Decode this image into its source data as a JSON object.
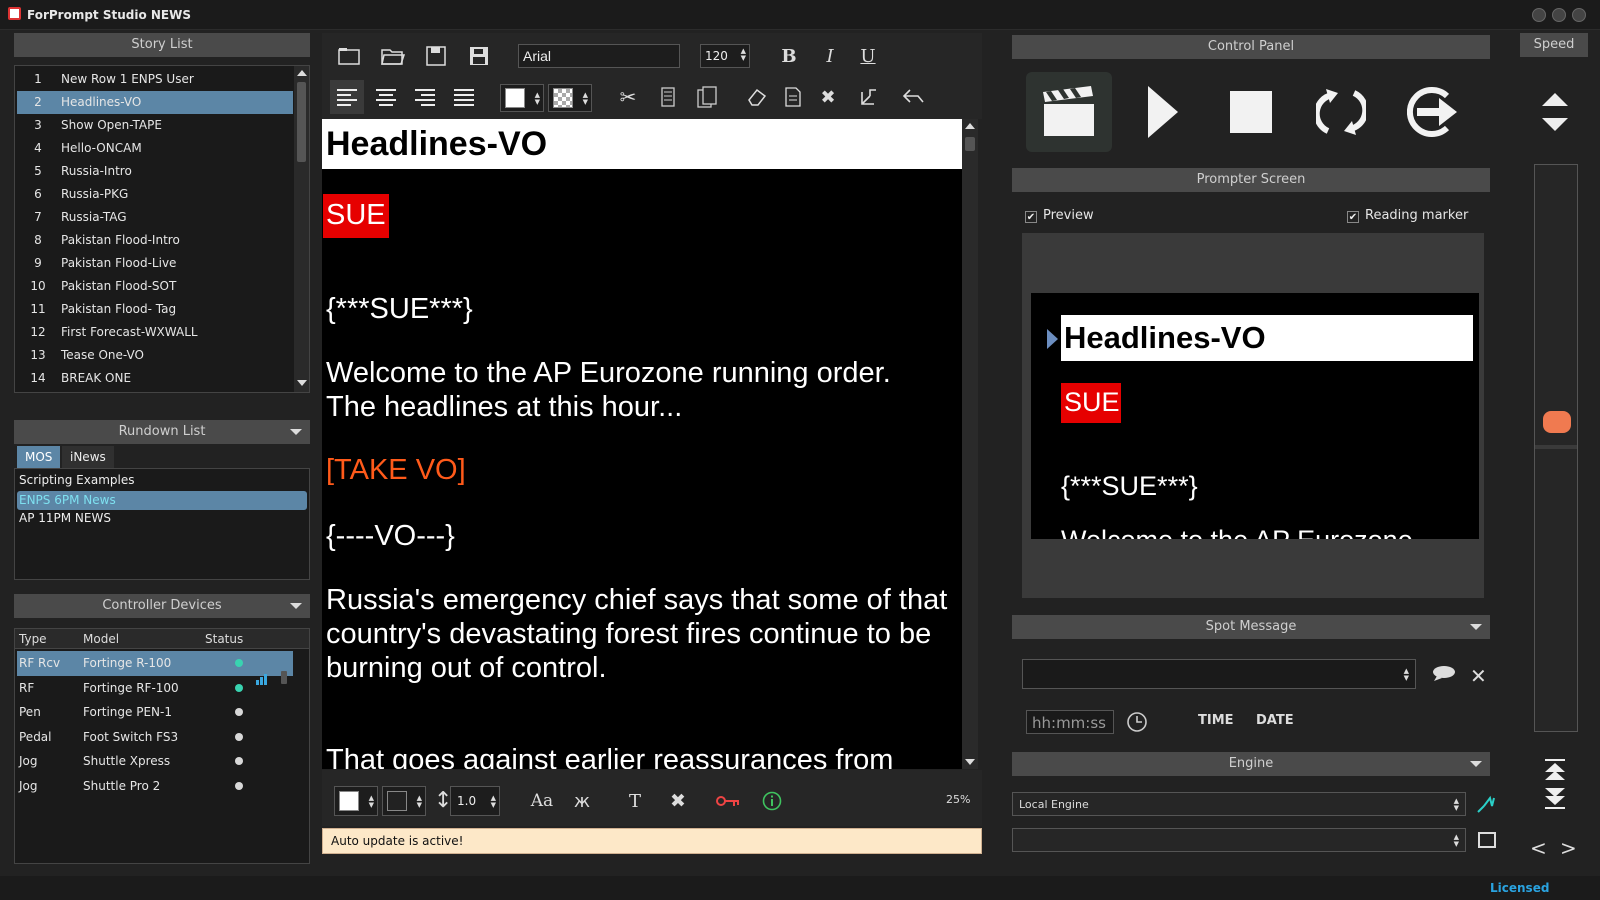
{
  "app": {
    "title": "ForPrompt Studio NEWS"
  },
  "story_list": {
    "header": "Story List",
    "items": [
      {
        "num": "1",
        "name": "New Row 1 ENPS User",
        "selected": false
      },
      {
        "num": "2",
        "name": "Headlines-VO",
        "selected": true
      },
      {
        "num": "3",
        "name": "Show Open-TAPE",
        "selected": false
      },
      {
        "num": "4",
        "name": "Hello-ONCAM",
        "selected": false
      },
      {
        "num": "5",
        "name": "Russia-Intro",
        "selected": false
      },
      {
        "num": "6",
        "name": "Russia-PKG",
        "selected": false
      },
      {
        "num": "7",
        "name": "Russia-TAG",
        "selected": false
      },
      {
        "num": "8",
        "name": "Pakistan Flood-Intro",
        "selected": false
      },
      {
        "num": "9",
        "name": "Pakistan Flood-Live",
        "selected": false
      },
      {
        "num": "10",
        "name": "Pakistan Flood-SOT",
        "selected": false
      },
      {
        "num": "11",
        "name": "Pakistan Flood- Tag",
        "selected": false
      },
      {
        "num": "12",
        "name": "First Forecast-WXWALL",
        "selected": false
      },
      {
        "num": "13",
        "name": "Tease One-VO",
        "selected": false
      },
      {
        "num": "14",
        "name": "BREAK ONE",
        "selected": false
      }
    ]
  },
  "rundown_list": {
    "header": "Rundown List",
    "tabs": [
      {
        "label": "MOS",
        "active": true
      },
      {
        "label": "iNews",
        "active": false
      }
    ],
    "items": [
      {
        "name": "Scripting Examples",
        "selected": false
      },
      {
        "name": "ENPS 6PM News",
        "selected": true
      },
      {
        "name": "AP 11PM NEWS",
        "selected": false
      }
    ]
  },
  "controller_devices": {
    "header": "Controller Devices",
    "columns": [
      "Type",
      "Model",
      "Status"
    ],
    "rows": [
      {
        "type": "RF Rcv",
        "model": "Fortinge R-100",
        "status_color": "#39d3b0",
        "selected": true
      },
      {
        "type": "RF",
        "model": "Fortinge RF-100",
        "status_color": "#39d3b0",
        "selected": false
      },
      {
        "type": "Pen",
        "model": "Fortinge PEN-1",
        "status_color": "#d8d8d8",
        "selected": false
      },
      {
        "type": "Pedal",
        "model": "Foot Switch FS3",
        "status_color": "#d8d8d8",
        "selected": false
      },
      {
        "type": "Jog",
        "model": "Shuttle Xpress",
        "status_color": "#d8d8d8",
        "selected": false
      },
      {
        "type": "Jog",
        "model": "Shuttle Pro 2",
        "status_color": "#d8d8d8",
        "selected": false
      }
    ]
  },
  "editor": {
    "font_name": "Arial",
    "font_size": "120",
    "bold_label": "B",
    "italic_label": "I",
    "underline_label": "U",
    "title": "Headlines-VO",
    "tag": "SUE",
    "code_sue": "{***SUE***}",
    "para1_line1": "Welcome to the AP Eurozone running order.",
    "para1_line2": "The headlines at this hour...",
    "take_vo": "[TAKE VO]",
    "code_vo": "{----VO---}",
    "para2_line1": "Russia's emergency chief says that some of that",
    "para2_line2": "country's devastating forest fires continue to be",
    "para2_line3": "burning out of control.",
    "para3_line1": "That goes against earlier reassurances from",
    "line_spacing": "1.0",
    "case_label": "Aa",
    "text_label": "T",
    "zoom": "25%",
    "auto_update": "Auto update is active!"
  },
  "control_panel": {
    "header": "Control Panel"
  },
  "prompter_screen": {
    "header": "Prompter Screen",
    "preview_label": "Preview",
    "preview_checked": true,
    "reading_marker_label": "Reading marker",
    "reading_marker_checked": true,
    "title": "Headlines-VO",
    "tag": "SUE",
    "code_sue": "{***SUE***}",
    "cut_line": "Welcome to the AP Eurozone"
  },
  "spot_message": {
    "header": "Spot Message",
    "time_placeholder": "hh:mm:ss",
    "time_button": "TIME",
    "date_button": "DATE"
  },
  "engine": {
    "header": "Engine",
    "selected": "Local Engine"
  },
  "speed": {
    "header": "Speed",
    "level": 0.45
  },
  "status_bar": {
    "license": "Licensed"
  },
  "colors": {
    "accent_blue": "#5c86a6",
    "tag_red": "#e60000",
    "take_orange": "#ff5a1a",
    "speed_knob": "#f07a50",
    "licensed": "#2aa3e0"
  }
}
